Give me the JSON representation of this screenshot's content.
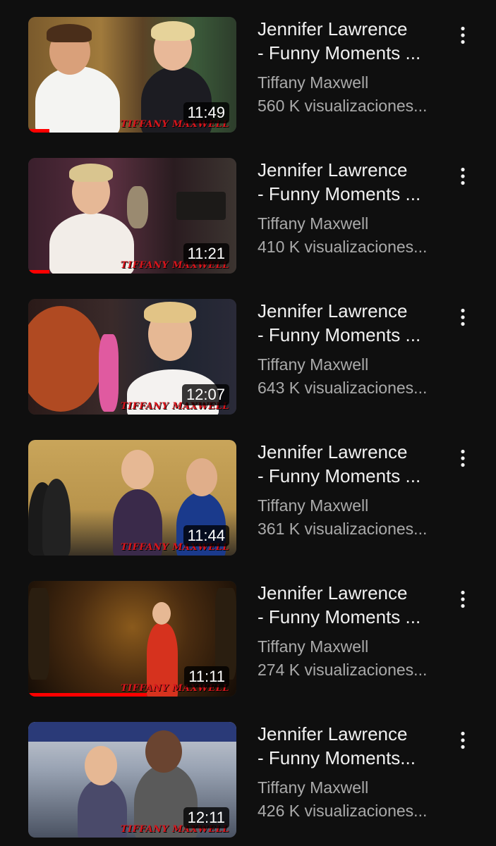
{
  "videos": [
    {
      "title_line1": "Jennifer Lawrence",
      "title_line2": "- Funny Moments ...",
      "channel": "Tiffany Maxwell",
      "views": "560 K visualizaciones...",
      "duration": "11:49",
      "watermark": "TIFFANY MAXWELL",
      "watch_progress": 0.1,
      "menu_icon": "more-vert-icon"
    },
    {
      "title_line1": "Jennifer Lawrence",
      "title_line2": "- Funny Moments ...",
      "channel": "Tiffany Maxwell",
      "views": "410 K visualizaciones...",
      "duration": "11:21",
      "watermark": "TIFFANY MAXWELL",
      "watch_progress": 0.1,
      "menu_icon": "more-vert-icon"
    },
    {
      "title_line1": "Jennifer Lawrence",
      "title_line2": "- Funny Moments ...",
      "channel": "Tiffany Maxwell",
      "views": "643 K visualizaciones...",
      "duration": "12:07",
      "watermark": "TIFFANY MAXWELL",
      "watch_progress": 0,
      "menu_icon": "more-vert-icon"
    },
    {
      "title_line1": "Jennifer Lawrence",
      "title_line2": "- Funny Moments ...",
      "channel": "Tiffany Maxwell",
      "views": "361 K visualizaciones...",
      "duration": "11:44",
      "watermark": "TIFFANY MAXWELL",
      "watch_progress": 0,
      "menu_icon": "more-vert-icon"
    },
    {
      "title_line1": "Jennifer Lawrence",
      "title_line2": "- Funny Moments ...",
      "channel": "Tiffany Maxwell",
      "views": "274 K visualizaciones...",
      "duration": "11:11",
      "watermark": "TIFFANY MAXWELL",
      "watch_progress": 0.57,
      "menu_icon": "more-vert-icon"
    },
    {
      "title_line1": "Jennifer Lawrence",
      "title_line2": "-  Funny Moments...",
      "channel": "Tiffany Maxwell",
      "views": "426 K visualizaciones...",
      "duration": "12:11",
      "watermark": "TIFFANY MAXWELL",
      "watch_progress": 0,
      "menu_icon": "more-vert-icon"
    }
  ],
  "colors": {
    "background": "#0f0f0f",
    "title": "#f1f1f1",
    "secondary_text": "#aaaaaa",
    "progress": "#ff0000",
    "watermark": "#d8141b"
  }
}
